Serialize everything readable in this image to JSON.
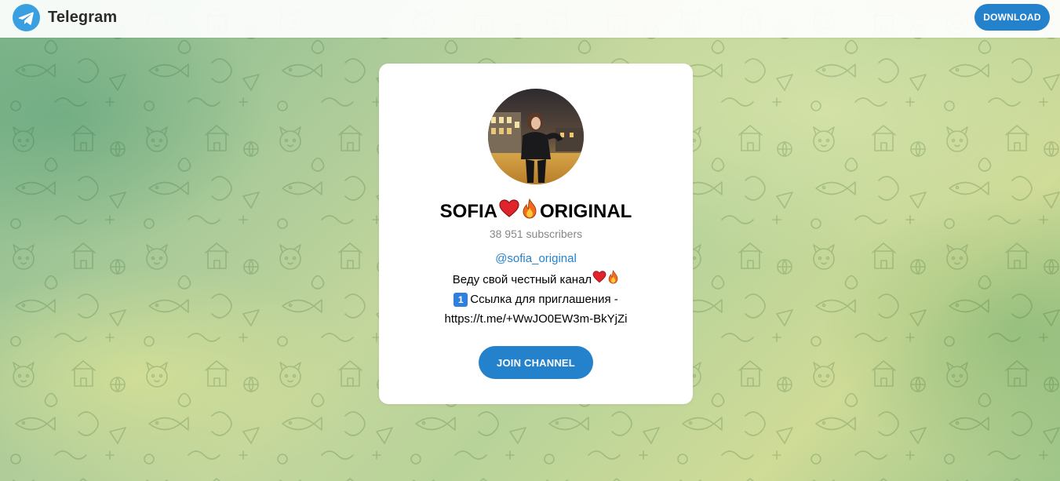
{
  "header": {
    "brand": "Telegram",
    "download_label": "DOWNLOAD"
  },
  "channel": {
    "title_part1": "SOFIA",
    "title_part2": "ORIGINAL",
    "title_emojis": [
      "heart-emoji",
      "fire-emoji"
    ],
    "subscribers": "38 951 subscribers",
    "username": "@sofia_original",
    "description_line1": "Веду свой честный канал",
    "description_line2_keycap": "1",
    "description_line2": "Ссылка для приглашения -",
    "description_line3": "https://t.me/+WwJO0EW3m-BkYjZi",
    "join_label": "JOIN CHANNEL"
  },
  "colors": {
    "accent": "#2481cc",
    "logo": "#3a9fe0",
    "muted_text": "#868686"
  }
}
